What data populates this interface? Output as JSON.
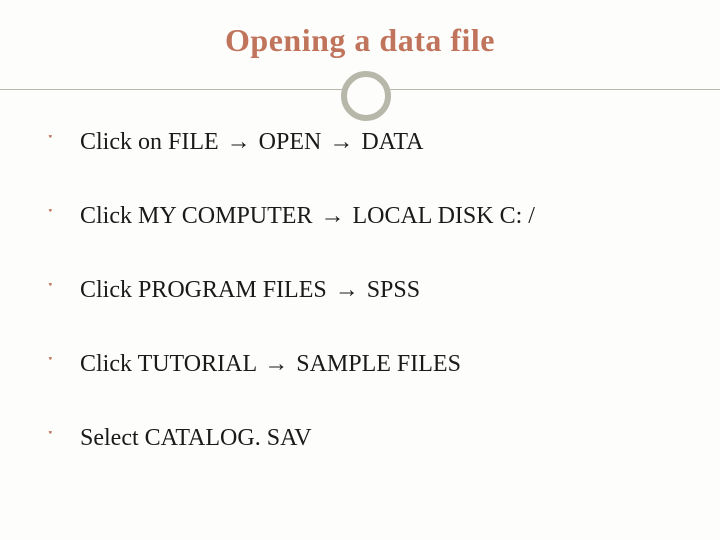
{
  "title": "Opening a data file",
  "bullet_glyph": "་",
  "arrow_glyph": "→",
  "items": [
    {
      "pre": "Click on FILE ",
      "mid1": " OPEN ",
      "mid2": " DATA",
      "arrows": 2
    },
    {
      "pre": "Click MY COMPUTER ",
      "mid1": " LOCAL DISK C: /",
      "arrows": 1
    },
    {
      "pre": "Click PROGRAM FILES ",
      "mid1": " SPSS",
      "arrows": 1
    },
    {
      "pre": "Click TUTORIAL ",
      "mid1": " SAMPLE FILES",
      "arrows": 1
    },
    {
      "pre": "Select CATALOG. SAV",
      "arrows": 0
    }
  ]
}
